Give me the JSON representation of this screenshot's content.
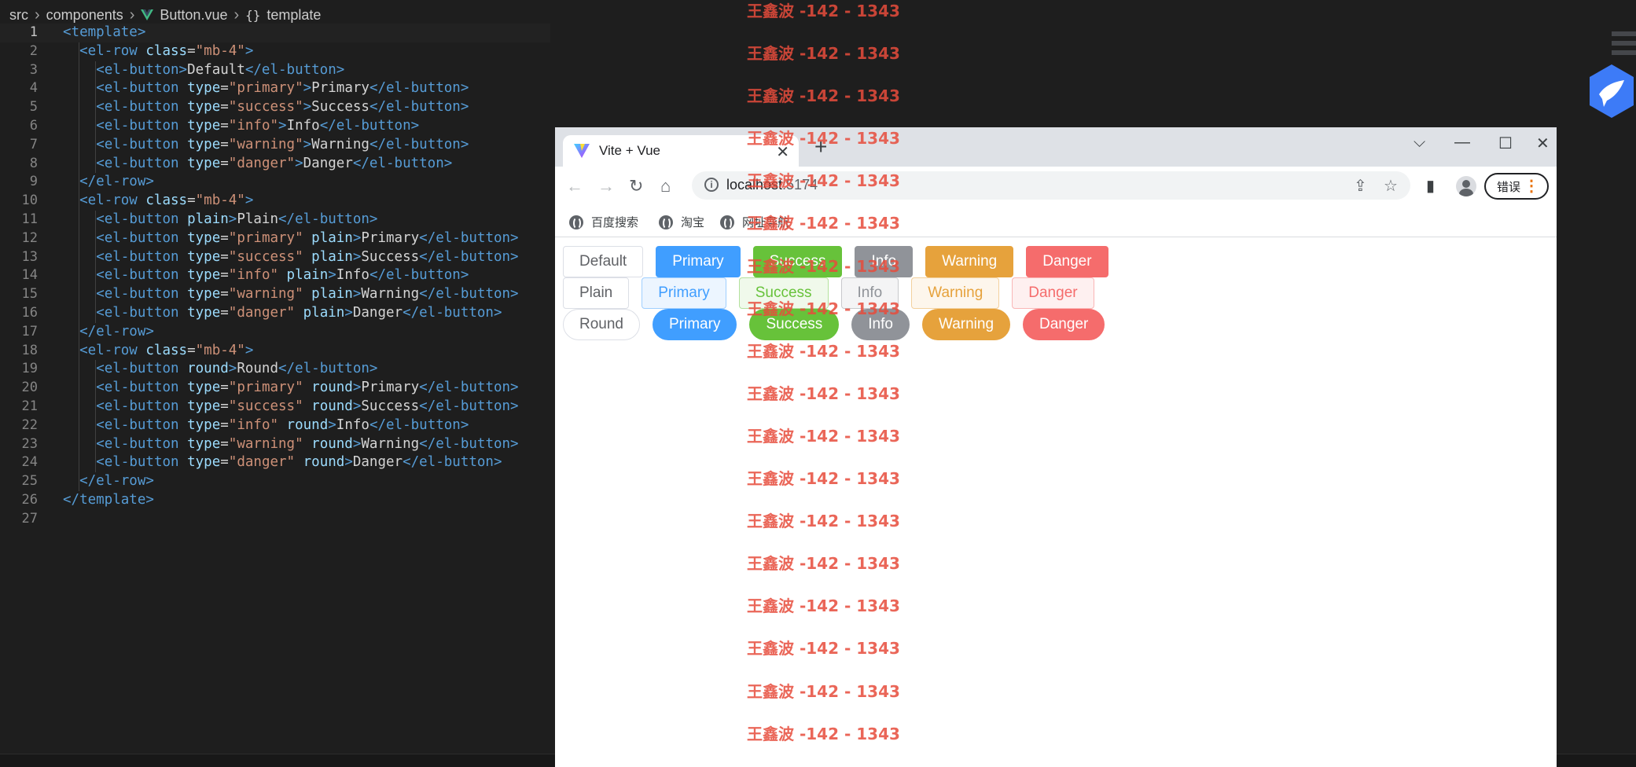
{
  "breadcrumb": {
    "items": [
      "src",
      "components",
      "Button.vue",
      "template"
    ],
    "braces": "{}"
  },
  "code": {
    "lines": [
      {
        "n": "1",
        "active": true,
        "indent": 0,
        "parts": [
          [
            "tg",
            "<template>"
          ]
        ]
      },
      {
        "n": "2",
        "indent": 2,
        "parts": [
          [
            "tg",
            "<el-row "
          ],
          [
            "at",
            "class"
          ],
          [
            "tx",
            "="
          ],
          [
            "st",
            "\"mb-4\""
          ],
          [
            "tg",
            ">"
          ]
        ]
      },
      {
        "n": "3",
        "indent": 4,
        "parts": [
          [
            "tg",
            "<el-button"
          ],
          [
            "tg",
            ">"
          ],
          [
            "tx",
            "Default"
          ],
          [
            "tg",
            "</el-button>"
          ]
        ]
      },
      {
        "n": "4",
        "indent": 4,
        "parts": [
          [
            "tg",
            "<el-button "
          ],
          [
            "at",
            "type"
          ],
          [
            "tx",
            "="
          ],
          [
            "st",
            "\"primary\""
          ],
          [
            "tg",
            ">"
          ],
          [
            "tx",
            "Primary"
          ],
          [
            "tg",
            "</el-button>"
          ]
        ]
      },
      {
        "n": "5",
        "indent": 4,
        "parts": [
          [
            "tg",
            "<el-button "
          ],
          [
            "at",
            "type"
          ],
          [
            "tx",
            "="
          ],
          [
            "st",
            "\"success\""
          ],
          [
            "tg",
            ">"
          ],
          [
            "tx",
            "Success"
          ],
          [
            "tg",
            "</el-button>"
          ]
        ]
      },
      {
        "n": "6",
        "indent": 4,
        "parts": [
          [
            "tg",
            "<el-button "
          ],
          [
            "at",
            "type"
          ],
          [
            "tx",
            "="
          ],
          [
            "st",
            "\"info\""
          ],
          [
            "tg",
            ">"
          ],
          [
            "tx",
            "Info"
          ],
          [
            "tg",
            "</el-button>"
          ]
        ]
      },
      {
        "n": "7",
        "indent": 4,
        "parts": [
          [
            "tg",
            "<el-button "
          ],
          [
            "at",
            "type"
          ],
          [
            "tx",
            "="
          ],
          [
            "st",
            "\"warning\""
          ],
          [
            "tg",
            ">"
          ],
          [
            "tx",
            "Warning"
          ],
          [
            "tg",
            "</el-button>"
          ]
        ]
      },
      {
        "n": "8",
        "indent": 4,
        "parts": [
          [
            "tg",
            "<el-button "
          ],
          [
            "at",
            "type"
          ],
          [
            "tx",
            "="
          ],
          [
            "st",
            "\"danger\""
          ],
          [
            "tg",
            ">"
          ],
          [
            "tx",
            "Danger"
          ],
          [
            "tg",
            "</el-button>"
          ]
        ]
      },
      {
        "n": "9",
        "indent": 2,
        "parts": [
          [
            "tg",
            "</el-row>"
          ]
        ]
      },
      {
        "n": "10",
        "indent": 2,
        "parts": [
          [
            "tg",
            "<el-row "
          ],
          [
            "at",
            "class"
          ],
          [
            "tx",
            "="
          ],
          [
            "st",
            "\"mb-4\""
          ],
          [
            "tg",
            ">"
          ]
        ]
      },
      {
        "n": "11",
        "indent": 4,
        "parts": [
          [
            "tg",
            "<el-button "
          ],
          [
            "at",
            "plain"
          ],
          [
            "tg",
            ">"
          ],
          [
            "tx",
            "Plain"
          ],
          [
            "tg",
            "</el-button>"
          ]
        ]
      },
      {
        "n": "12",
        "indent": 4,
        "parts": [
          [
            "tg",
            "<el-button "
          ],
          [
            "at",
            "type"
          ],
          [
            "tx",
            "="
          ],
          [
            "st",
            "\"primary\""
          ],
          [
            "at",
            " plain"
          ],
          [
            "tg",
            ">"
          ],
          [
            "tx",
            "Primary"
          ],
          [
            "tg",
            "</el-button>"
          ]
        ]
      },
      {
        "n": "13",
        "indent": 4,
        "parts": [
          [
            "tg",
            "<el-button "
          ],
          [
            "at",
            "type"
          ],
          [
            "tx",
            "="
          ],
          [
            "st",
            "\"success\""
          ],
          [
            "at",
            " plain"
          ],
          [
            "tg",
            ">"
          ],
          [
            "tx",
            "Success"
          ],
          [
            "tg",
            "</el-button>"
          ]
        ]
      },
      {
        "n": "14",
        "indent": 4,
        "parts": [
          [
            "tg",
            "<el-button "
          ],
          [
            "at",
            "type"
          ],
          [
            "tx",
            "="
          ],
          [
            "st",
            "\"info\""
          ],
          [
            "at",
            " plain"
          ],
          [
            "tg",
            ">"
          ],
          [
            "tx",
            "Info"
          ],
          [
            "tg",
            "</el-button>"
          ]
        ]
      },
      {
        "n": "15",
        "indent": 4,
        "parts": [
          [
            "tg",
            "<el-button "
          ],
          [
            "at",
            "type"
          ],
          [
            "tx",
            "="
          ],
          [
            "st",
            "\"warning\""
          ],
          [
            "at",
            " plain"
          ],
          [
            "tg",
            ">"
          ],
          [
            "tx",
            "Warning"
          ],
          [
            "tg",
            "</el-button>"
          ]
        ]
      },
      {
        "n": "16",
        "indent": 4,
        "parts": [
          [
            "tg",
            "<el-button "
          ],
          [
            "at",
            "type"
          ],
          [
            "tx",
            "="
          ],
          [
            "st",
            "\"danger\""
          ],
          [
            "at",
            " plain"
          ],
          [
            "tg",
            ">"
          ],
          [
            "tx",
            "Danger"
          ],
          [
            "tg",
            "</el-button>"
          ]
        ]
      },
      {
        "n": "17",
        "indent": 2,
        "parts": [
          [
            "tg",
            "</el-row>"
          ]
        ]
      },
      {
        "n": "18",
        "indent": 2,
        "parts": [
          [
            "tg",
            "<el-row "
          ],
          [
            "at",
            "class"
          ],
          [
            "tx",
            "="
          ],
          [
            "st",
            "\"mb-4\""
          ],
          [
            "tg",
            ">"
          ]
        ]
      },
      {
        "n": "19",
        "indent": 4,
        "parts": [
          [
            "tg",
            "<el-button "
          ],
          [
            "at",
            "round"
          ],
          [
            "tg",
            ">"
          ],
          [
            "tx",
            "Round"
          ],
          [
            "tg",
            "</el-button>"
          ]
        ]
      },
      {
        "n": "20",
        "indent": 4,
        "parts": [
          [
            "tg",
            "<el-button "
          ],
          [
            "at",
            "type"
          ],
          [
            "tx",
            "="
          ],
          [
            "st",
            "\"primary\""
          ],
          [
            "at",
            " round"
          ],
          [
            "tg",
            ">"
          ],
          [
            "tx",
            "Primary"
          ],
          [
            "tg",
            "</el-button>"
          ]
        ]
      },
      {
        "n": "21",
        "indent": 4,
        "parts": [
          [
            "tg",
            "<el-button "
          ],
          [
            "at",
            "type"
          ],
          [
            "tx",
            "="
          ],
          [
            "st",
            "\"success\""
          ],
          [
            "at",
            " round"
          ],
          [
            "tg",
            ">"
          ],
          [
            "tx",
            "Success"
          ],
          [
            "tg",
            "</el-button>"
          ]
        ]
      },
      {
        "n": "22",
        "indent": 4,
        "parts": [
          [
            "tg",
            "<el-button "
          ],
          [
            "at",
            "type"
          ],
          [
            "tx",
            "="
          ],
          [
            "st",
            "\"info\""
          ],
          [
            "at",
            " round"
          ],
          [
            "tg",
            ">"
          ],
          [
            "tx",
            "Info"
          ],
          [
            "tg",
            "</el-button>"
          ]
        ]
      },
      {
        "n": "23",
        "indent": 4,
        "parts": [
          [
            "tg",
            "<el-button "
          ],
          [
            "at",
            "type"
          ],
          [
            "tx",
            "="
          ],
          [
            "st",
            "\"warning\""
          ],
          [
            "at",
            " round"
          ],
          [
            "tg",
            ">"
          ],
          [
            "tx",
            "Warning"
          ],
          [
            "tg",
            "</el-button>"
          ]
        ]
      },
      {
        "n": "24",
        "indent": 4,
        "parts": [
          [
            "tg",
            "<el-button "
          ],
          [
            "at",
            "type"
          ],
          [
            "tx",
            "="
          ],
          [
            "st",
            "\"danger\""
          ],
          [
            "at",
            " round"
          ],
          [
            "tg",
            ">"
          ],
          [
            "tx",
            "Danger"
          ],
          [
            "tg",
            "</el-button>"
          ]
        ]
      },
      {
        "n": "25",
        "indent": 2,
        "parts": [
          [
            "tg",
            "</el-row>"
          ]
        ]
      },
      {
        "n": "26",
        "indent": 0,
        "parts": [
          [
            "tg",
            "</template>"
          ]
        ]
      },
      {
        "n": "27",
        "indent": 0,
        "parts": []
      }
    ]
  },
  "browser": {
    "tab_title": "Vite + Vue",
    "new_tab": "+",
    "url_host": "localhost",
    "url_port": ":5174",
    "error_label": "错误",
    "bookmarks": [
      "百度搜索",
      "淘宝",
      "网址导航"
    ]
  },
  "buttons": {
    "row1": [
      {
        "label": "Default",
        "type": "default"
      },
      {
        "label": "Primary",
        "type": "primary"
      },
      {
        "label": "Success",
        "type": "success"
      },
      {
        "label": "Info",
        "type": "info"
      },
      {
        "label": "Warning",
        "type": "warning"
      },
      {
        "label": "Danger",
        "type": "danger"
      }
    ],
    "row2": [
      {
        "label": "Plain",
        "type": "default"
      },
      {
        "label": "Primary",
        "type": "primary"
      },
      {
        "label": "Success",
        "type": "success"
      },
      {
        "label": "Info",
        "type": "info"
      },
      {
        "label": "Warning",
        "type": "warning"
      },
      {
        "label": "Danger",
        "type": "danger"
      }
    ],
    "row3": [
      {
        "label": "Round",
        "type": "default"
      },
      {
        "label": "Primary",
        "type": "primary"
      },
      {
        "label": "Success",
        "type": "success"
      },
      {
        "label": "Info",
        "type": "info"
      },
      {
        "label": "Warning",
        "type": "warning"
      },
      {
        "label": "Danger",
        "type": "danger"
      }
    ]
  },
  "watermark": {
    "text": "王鑫波 -142 - 1343",
    "repeat": 18
  },
  "colors": {
    "primary": "#409eff",
    "success": "#67c23a",
    "info": "#909399",
    "warning": "#e6a23c",
    "danger": "#f56c6c",
    "watermark": "#e74c3c"
  }
}
